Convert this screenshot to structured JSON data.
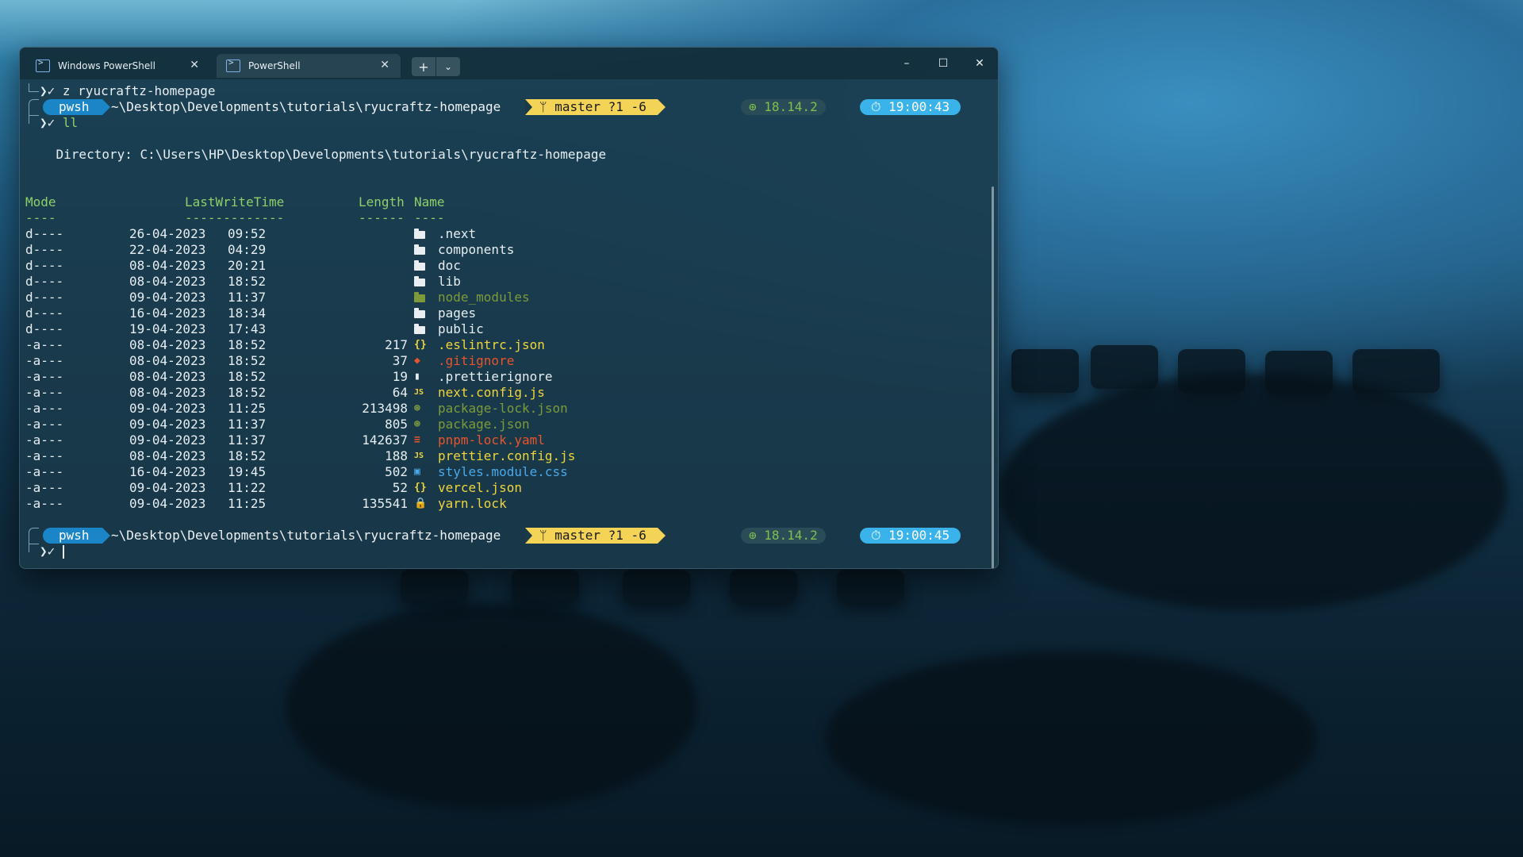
{
  "tabs": [
    {
      "label": "Windows PowerShell"
    },
    {
      "label": "PowerShell"
    }
  ],
  "tab_buttons": {
    "new": "+",
    "dropdown": "⌄"
  },
  "window_controls": {
    "minimize": "–",
    "maximize": "☐",
    "close": "✕"
  },
  "session": {
    "cmd1": "z ryucraftz-homepage",
    "cmd2": "ll",
    "prompt_symbol": "❯✓",
    "shell": "pwsh",
    "path": "~\\Desktop\\Developments\\tutorials\\ryucraftz-homepage",
    "git": "ᛘ master ?1 -6",
    "node": "⊕ 18.14.2",
    "time1": "⏱ 19:00:43",
    "time2": "⏱ 19:00:45",
    "directory": "    Directory: C:\\Users\\HP\\Desktop\\Developments\\tutorials\\ryucraftz-homepage",
    "headers": {
      "mode": "Mode",
      "lwt": "LastWriteTime",
      "length": "Length",
      "name": "Name"
    },
    "underlines": {
      "mode": "----",
      "lwt": "-------------",
      "length": "------",
      "name": "----"
    }
  },
  "files": [
    {
      "mode": "d----",
      "date": "26-04-2023",
      "time": "09:52",
      "length": "",
      "icon": "folder",
      "name": ".next",
      "color": "#e6eef2"
    },
    {
      "mode": "d----",
      "date": "22-04-2023",
      "time": "04:29",
      "length": "",
      "icon": "folder",
      "name": "components",
      "color": "#e6eef2"
    },
    {
      "mode": "d----",
      "date": "08-04-2023",
      "time": "20:21",
      "length": "",
      "icon": "folder",
      "name": "doc",
      "color": "#e6eef2"
    },
    {
      "mode": "d----",
      "date": "08-04-2023",
      "time": "18:52",
      "length": "",
      "icon": "folder",
      "name": "lib",
      "color": "#e6eef2"
    },
    {
      "mode": "d----",
      "date": "09-04-2023",
      "time": "11:37",
      "length": "",
      "icon": "folder-green",
      "name": "node_modules",
      "color": "#7c9a3a"
    },
    {
      "mode": "d----",
      "date": "16-04-2023",
      "time": "18:34",
      "length": "",
      "icon": "folder",
      "name": "pages",
      "color": "#e6eef2"
    },
    {
      "mode": "d----",
      "date": "19-04-2023",
      "time": "17:43",
      "length": "",
      "icon": "folder",
      "name": "public",
      "color": "#e6eef2"
    },
    {
      "mode": "-a---",
      "date": "08-04-2023",
      "time": "18:52",
      "length": "217",
      "icon": "json",
      "name": ".eslintrc.json",
      "color": "#f0d43c"
    },
    {
      "mode": "-a---",
      "date": "08-04-2023",
      "time": "18:52",
      "length": "37",
      "icon": "git",
      "name": ".gitignore",
      "color": "#e8542c"
    },
    {
      "mode": "-a---",
      "date": "08-04-2023",
      "time": "18:52",
      "length": "19",
      "icon": "file",
      "name": ".prettierignore",
      "color": "#e6eef2"
    },
    {
      "mode": "-a---",
      "date": "08-04-2023",
      "time": "18:52",
      "length": "64",
      "icon": "js",
      "name": "next.config.js",
      "color": "#f0d43c"
    },
    {
      "mode": "-a---",
      "date": "09-04-2023",
      "time": "11:25",
      "length": "213498",
      "icon": "npm",
      "name": "package-lock.json",
      "color": "#7c9a3a"
    },
    {
      "mode": "-a---",
      "date": "09-04-2023",
      "time": "11:37",
      "length": "805",
      "icon": "npm",
      "name": "package.json",
      "color": "#7c9a3a"
    },
    {
      "mode": "-a---",
      "date": "09-04-2023",
      "time": "11:37",
      "length": "142637",
      "icon": "yaml",
      "name": "pnpm-lock.yaml",
      "color": "#e8542c"
    },
    {
      "mode": "-a---",
      "date": "08-04-2023",
      "time": "18:52",
      "length": "188",
      "icon": "js",
      "name": "prettier.config.js",
      "color": "#f0d43c"
    },
    {
      "mode": "-a---",
      "date": "16-04-2023",
      "time": "19:45",
      "length": "502",
      "icon": "css",
      "name": "styles.module.css",
      "color": "#4aa8e8"
    },
    {
      "mode": "-a---",
      "date": "09-04-2023",
      "time": "11:22",
      "length": "52",
      "icon": "json",
      "name": "vercel.json",
      "color": "#f0d43c"
    },
    {
      "mode": "-a---",
      "date": "09-04-2023",
      "time": "11:25",
      "length": "135541",
      "icon": "lock",
      "name": "yarn.lock",
      "color": "#f0d43c"
    }
  ],
  "icon_glyphs": {
    "json": "{}",
    "git": "◆",
    "file": "▮",
    "js": "JS",
    "npm": "⊛",
    "yaml": "≡",
    "css": "▣",
    "lock": "🔒"
  },
  "icon_colors": {
    "json": "#f0d43c",
    "git": "#e8542c",
    "file": "#e6eef2",
    "js": "#f0d43c",
    "npm": "#7c9a3a",
    "yaml": "#e8542c",
    "css": "#4aa8e8",
    "lock": "#f0b02a"
  }
}
